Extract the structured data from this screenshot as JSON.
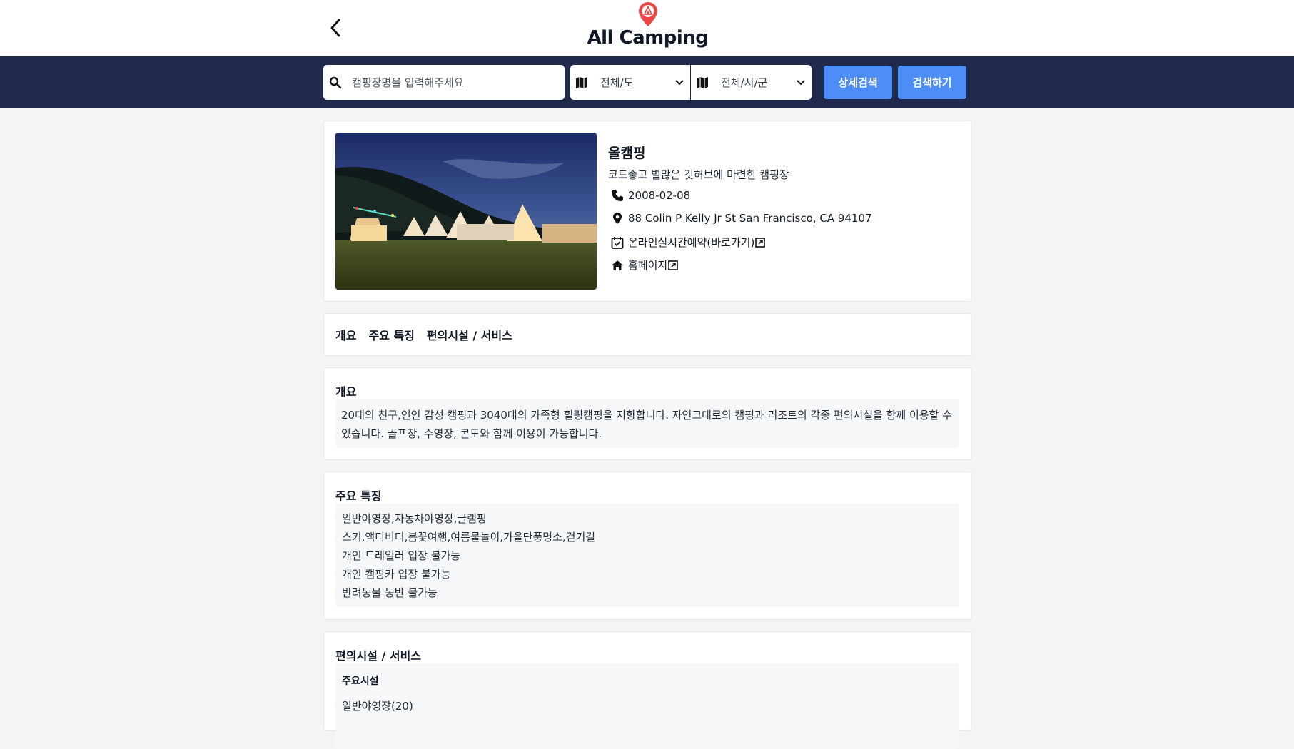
{
  "header": {
    "logo_text": "All Camping",
    "brand_color": "#ef4444"
  },
  "search": {
    "placeholder": "캠핑장명을 입력해주세요",
    "province_select": "전체/도",
    "city_select": "전체/시/군",
    "detail_button": "상세검색",
    "search_button": "검색하기"
  },
  "camp": {
    "name": "올캠핑",
    "tagline": "코드좋고 별많은 깃허브에 마련한 캠핑장",
    "phone": "2008-02-08",
    "address": "88 Colin P Kelly Jr St San Francisco, CA 94107",
    "booking_link": "온라인실시간예약(바로가기)",
    "homepage_link": "홈페이지"
  },
  "tabs": [
    "개요",
    "주요 특징",
    "편의시설 / 서비스"
  ],
  "overview": {
    "title": "개요",
    "text": "20대의 친구,연인 감성 캠핑과 3040대의 가족형 힐링캠핑을 지향합니다. 자연그대로의 캠핑과 리조트의 각종 편의시설을 함께 이용할 수 있습니다. 골프장, 수영장, 콘도와 함께 이용이 가능합니다."
  },
  "features": {
    "title": "주요 특징",
    "lines": [
      "일반야영장,자동차야영장,글램핑",
      "스키,액티비티,봄꽃여행,여름물놀이,가을단풍명소,걷기길",
      "개인 트레일러 입장 불가능",
      "개인 캠핑카 입장 불가능",
      "반려동물 동반 불가능"
    ]
  },
  "facilities": {
    "title": "편의시설 / 서비스",
    "subtitle": "주요시설",
    "item": "일반야영장(20)"
  },
  "colors": {
    "navy": "#1f2a4d",
    "button_blue": "#4c8df6"
  }
}
